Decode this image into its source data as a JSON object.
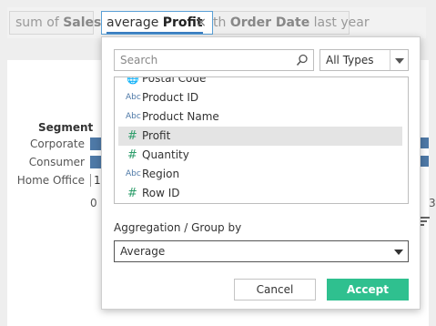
{
  "query_bar": {
    "chip1_prefix": "sum of",
    "chip1_field": "Sales",
    "chip2_prefix": "average",
    "chip2_field": "Profit",
    "chip2_close": "×",
    "chip3_prefix": "th",
    "chip3_field": "Order Date",
    "chip3_suffix": "last year"
  },
  "chart": {
    "segment_title": "Segment",
    "rows": [
      "Corporate",
      "Consumer",
      "Home Office"
    ],
    "home_office_value": "1",
    "tick_zero": "0",
    "tick_right": "3"
  },
  "popup": {
    "search_placeholder": "Search",
    "type_filter": "All Types",
    "fields": [
      {
        "icon": "globe",
        "label": "Postal Code"
      },
      {
        "icon": "Abc",
        "label": "Product ID"
      },
      {
        "icon": "Abc",
        "label": "Product Name"
      },
      {
        "icon": "#",
        "label": "Profit"
      },
      {
        "icon": "#",
        "label": "Quantity"
      },
      {
        "icon": "Abc",
        "label": "Region"
      },
      {
        "icon": "#",
        "label": "Row ID"
      }
    ],
    "selected_field": "Profit",
    "aggregation_label": "Aggregation / Group by",
    "aggregation_value": "Average",
    "cancel_label": "Cancel",
    "accept_label": "Accept"
  },
  "colors": {
    "accent_green": "#2fc08f",
    "bar_blue": "#4e79a7",
    "selection_border": "#5aa0d6"
  }
}
